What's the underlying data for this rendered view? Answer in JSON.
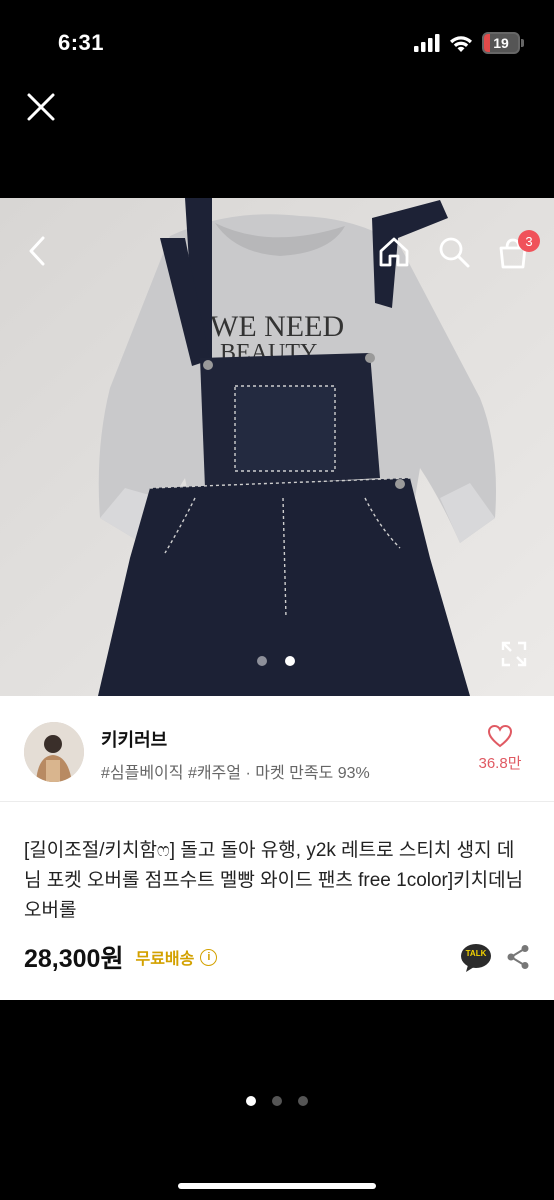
{
  "status_bar": {
    "time": "6:31",
    "battery_level": "19",
    "battery_color": "#e24a4a",
    "battery_fraction": 0.19,
    "icons": [
      "signal-icon",
      "wifi-icon",
      "battery-icon"
    ]
  },
  "header": {
    "close_icon": "close-icon"
  },
  "image_nav": {
    "back_icon": "back-icon",
    "home_icon": "home-icon",
    "search_icon": "search-icon",
    "cart_icon": "cart-icon",
    "cart_count": "3",
    "expand_icon": "expand-icon",
    "slides_total": 2,
    "slide_active": 2
  },
  "seller": {
    "name": "키키러브",
    "tags": "#심플베이직 #캐주얼 · 마켓 만족도 93%"
  },
  "like": {
    "count": "36.8만",
    "icon": "heart-icon",
    "color": "#e05a63"
  },
  "product": {
    "title": "[길이조절/키치함ෆ] 돌고 돌아 유행, y2k 레트로 스티치 생지 데님 포켓 오버롤 점프수트 멜빵 와이드 팬츠 free 1color]키치데님오버롤",
    "price": "28,300원",
    "shipping": "무료배송",
    "shipping_color": "#d3a100"
  },
  "actions": {
    "kakao_label": "TALK",
    "share_icon": "share-icon"
  },
  "pager": {
    "total": 3,
    "active": 1
  }
}
